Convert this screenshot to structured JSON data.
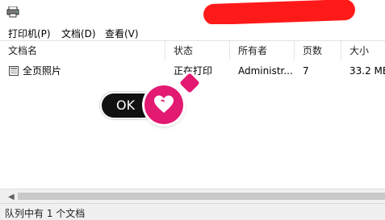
{
  "menu": {
    "printer": "打印机(P)",
    "document": "文档(D)",
    "view": "查看(V)"
  },
  "columns": {
    "name": "文档名",
    "status": "状态",
    "owner": "所有者",
    "pages": "页数",
    "size": "大小"
  },
  "jobs": [
    {
      "name": "全页照片",
      "status": "正在打印",
      "owner": "Administr...",
      "pages": "7",
      "size": "33.2 MB"
    }
  ],
  "overlay": {
    "ok_label": "OK"
  },
  "status_bar": {
    "text": "队列中有 1 个文档"
  },
  "colors": {
    "redaction": "#ff1a1a",
    "badge": "#e21a72"
  },
  "icons": {
    "app": "printer-icon",
    "document": "document-icon",
    "heart": "heart-icon"
  }
}
